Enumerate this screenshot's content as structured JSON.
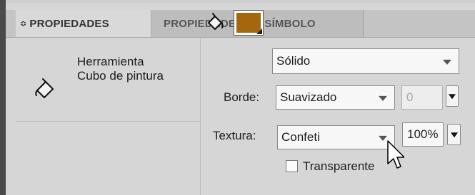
{
  "tabs": [
    {
      "label": "PROPIEDADES",
      "active": true,
      "collapse_glyph": "≎"
    },
    {
      "label": "PROPIEDADES DE SÍMBOLO",
      "active": false
    }
  ],
  "tool": {
    "name_line1": "Herramienta",
    "name_line2": "Cubo de pintura",
    "icon": "paint-bucket-icon"
  },
  "fill": {
    "color": "#a5670e",
    "style_value": "Sólido"
  },
  "border": {
    "label": "Borde:",
    "value": "Suavizado",
    "amount": "0"
  },
  "texture": {
    "label": "Textura:",
    "value": "Confeti",
    "percent": "100%"
  },
  "transparent": {
    "label": "Transparente",
    "checked": false
  }
}
